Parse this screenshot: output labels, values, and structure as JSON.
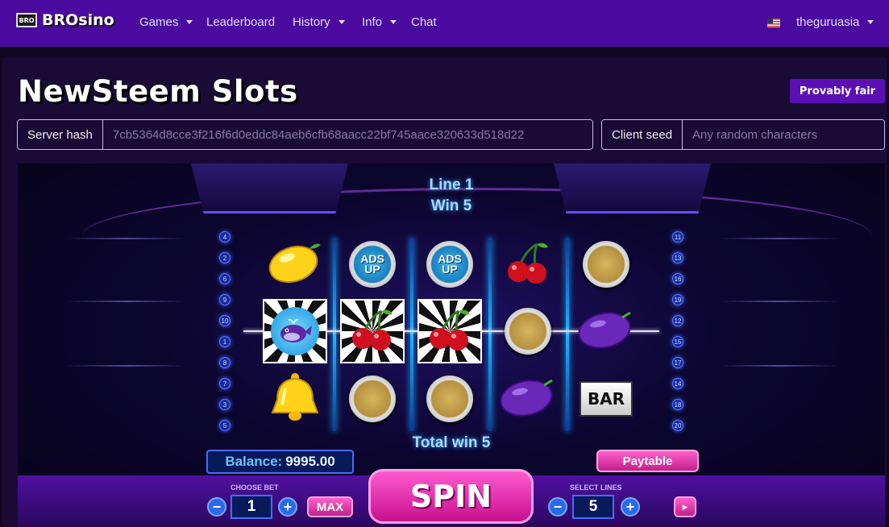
{
  "nav": {
    "brand_logo": "BRO",
    "brand_name": "BROsino",
    "items": [
      {
        "label": "Games",
        "dropdown": true
      },
      {
        "label": "Leaderboard",
        "dropdown": false
      },
      {
        "label": "History",
        "dropdown": true
      },
      {
        "label": "Info",
        "dropdown": true
      },
      {
        "label": "Chat",
        "dropdown": false
      }
    ],
    "user": "theguruasia"
  },
  "page": {
    "title": "NewSteem Slots",
    "provably_fair_label": "Provably fair",
    "server_hash_label": "Server hash",
    "server_hash_value": "7cb5364d8cce3f216f6d0eddc84aeb6cfb68aacc22bf745aace320633d518d22",
    "client_seed_label": "Client seed",
    "client_seed_placeholder": "Any random characters"
  },
  "game": {
    "line_text": "Line 1",
    "win_text": "Win 5",
    "total_win_text": "Total win 5",
    "left_line_numbers": [
      "4",
      "2",
      "6",
      "9",
      "10",
      "1",
      "8",
      "7",
      "3",
      "5"
    ],
    "right_line_numbers": [
      "11",
      "13",
      "16",
      "19",
      "12",
      "15",
      "17",
      "14",
      "18",
      "20"
    ],
    "reels": [
      [
        "lemon",
        "whale",
        "bell"
      ],
      [
        "adsup",
        "cherry",
        "coin"
      ],
      [
        "adsup",
        "cherry",
        "coin"
      ],
      [
        "cherry",
        "coin",
        "plum"
      ],
      [
        "coin",
        "plum",
        "bar"
      ]
    ],
    "highlighted": [
      [
        1,
        0
      ],
      [
        1,
        1
      ],
      [
        1,
        2
      ]
    ],
    "symbol_text": {
      "adsup": "ADS UP",
      "bar": "BAR"
    },
    "balance_label": "Balance:",
    "balance_value": "9995.00",
    "paytable_label": "Paytable",
    "spin_label": "SPIN",
    "choose_bet_label": "CHOOSE BET",
    "bet_value": "1",
    "max_label": "MAX",
    "select_lines_label": "SELECT LINES",
    "lines_value": "5"
  }
}
